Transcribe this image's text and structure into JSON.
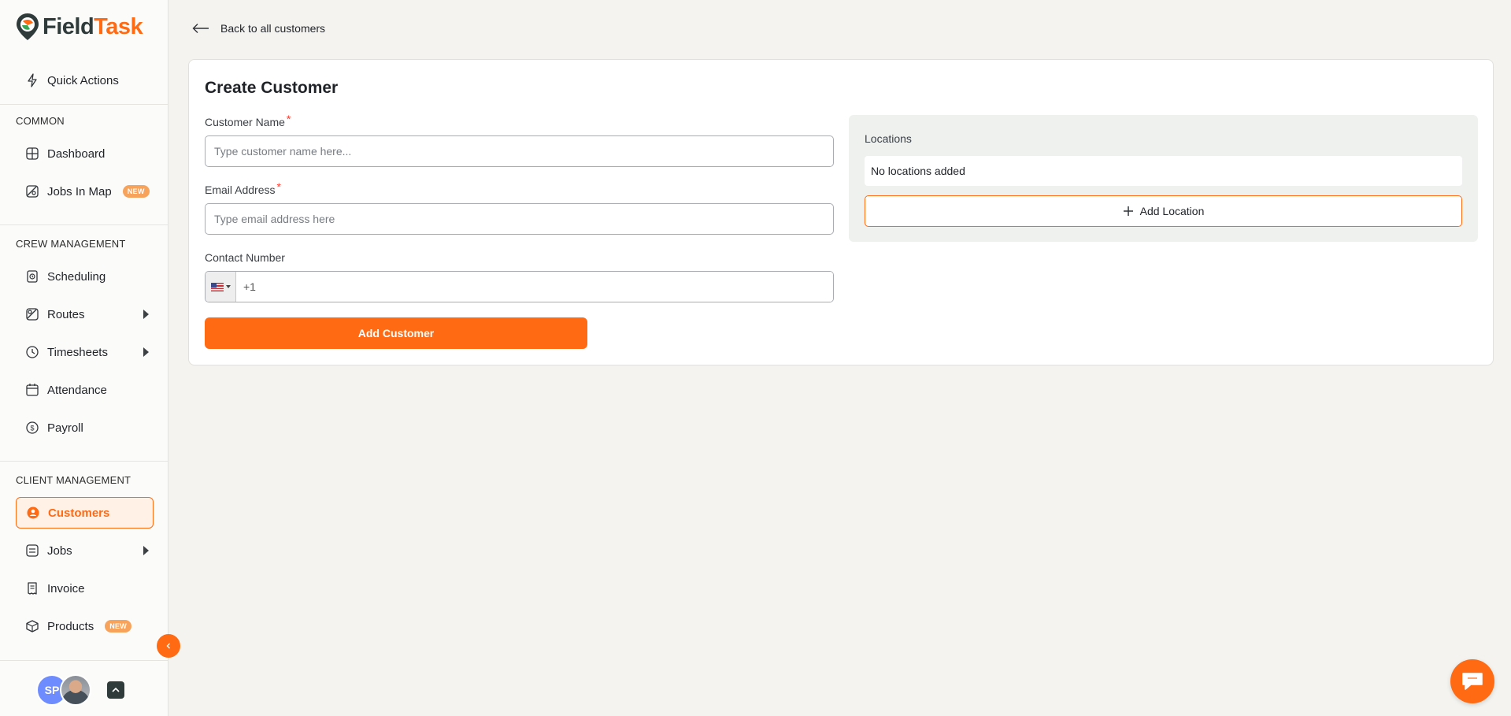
{
  "app": {
    "logo_field": "Field",
    "logo_task": "Task",
    "accent_color": "#ff6a13"
  },
  "sidebar": {
    "quick_actions": "Quick Actions",
    "sections": {
      "common": "COMMON",
      "crew": "CREW MANAGEMENT",
      "client": "CLIENT MANAGEMENT"
    },
    "items": {
      "dashboard": "Dashboard",
      "jobs_in_map": "Jobs In Map",
      "scheduling": "Scheduling",
      "routes": "Routes",
      "timesheets": "Timesheets",
      "attendance": "Attendance",
      "payroll": "Payroll",
      "customers": "Customers",
      "jobs": "Jobs",
      "invoice": "Invoice",
      "products": "Products"
    },
    "badge_new": "NEW",
    "user_initials": "SP"
  },
  "main": {
    "back_label": "Back to all customers",
    "card_title": "Create Customer",
    "customer_name_label": "Customer Name",
    "customer_name_placeholder": "Type customer name here...",
    "email_label": "Email Address",
    "email_placeholder": "Type email address here",
    "contact_label": "Contact Number",
    "phone_prefix": "+1",
    "required_mark": "*",
    "add_customer_label": "Add Customer",
    "locations_title": "Locations",
    "no_locations": "No locations added",
    "add_location_label": "Add Location"
  }
}
